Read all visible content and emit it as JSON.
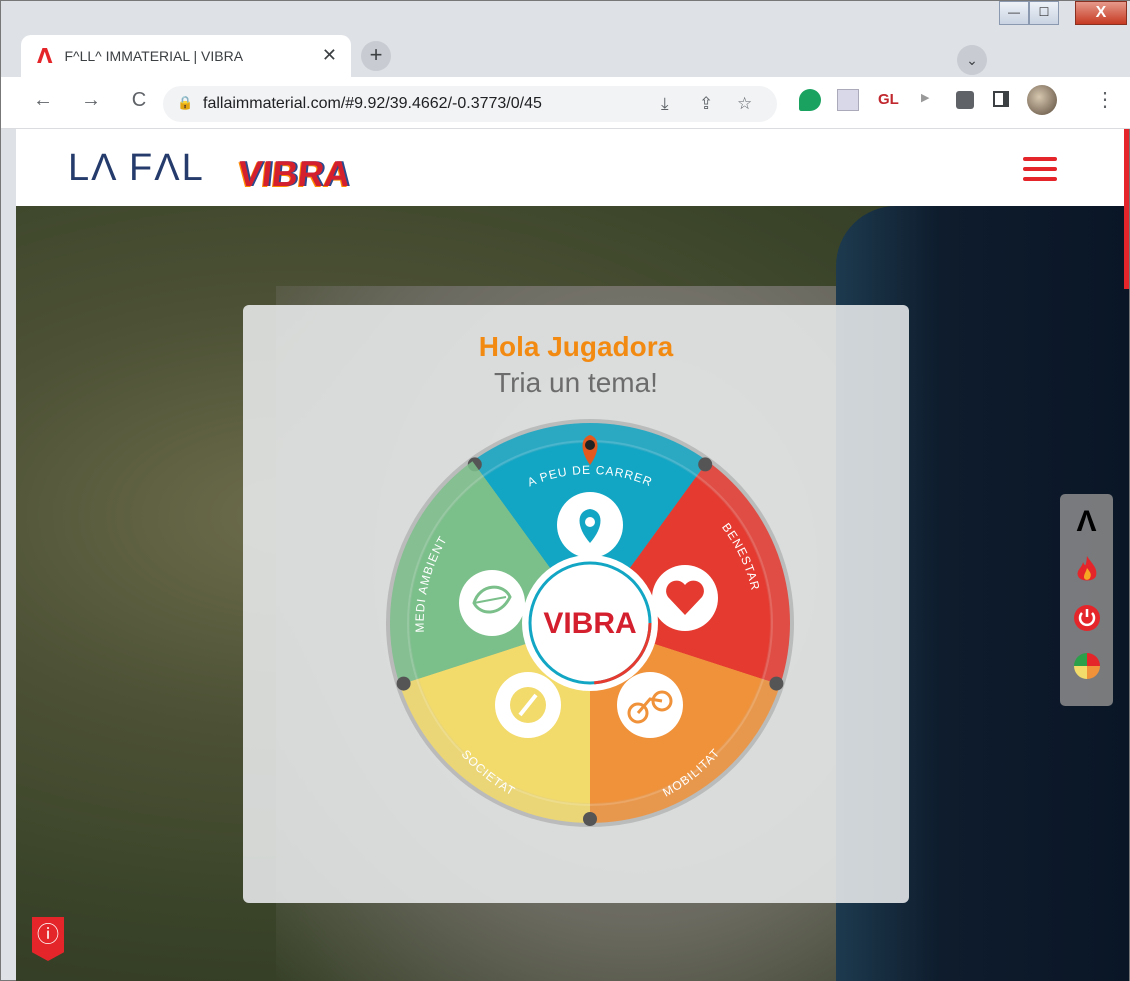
{
  "browser": {
    "tab_title": "F^LL^ IMMATERIAL | VIBRA",
    "tab_favicon": "Λ",
    "tab_close": "✕",
    "new_tab": "+",
    "tab_search": "⌄",
    "url": "fallaimmaterial.com/#9.92/39.4662/-0.3773/0/45",
    "window_minimize": "—",
    "window_maximize": "☐",
    "window_close": "X",
    "back": "←",
    "forward": "→",
    "reload": "C",
    "lock": "🔒",
    "install": "⤓",
    "share": "⇪",
    "star": "☆",
    "ext_gl": "GL",
    "menu": "⋮"
  },
  "site": {
    "logo_text": "LΛ FΛL",
    "logo_vibra": "VIBRA"
  },
  "game": {
    "greeting": "Hola Jugadora",
    "prompt": "Tria un tema!",
    "center_label": "VIBRA",
    "segments": [
      {
        "label": "A PEU DE CARRER",
        "color": "#12a6c4",
        "icon": "location-pin-icon"
      },
      {
        "label": "BENESTAR",
        "color": "#e53a2f",
        "icon": "heart-icon"
      },
      {
        "label": "MOBILITAT",
        "color": "#f0923a",
        "icon": "bicycle-icon"
      },
      {
        "label": "SOCIETAT",
        "color": "#f2da6b",
        "icon": "compass-icon"
      },
      {
        "label": "MEDI AMBIENT",
        "color": "#7bbf8b",
        "icon": "leaf-icon"
      }
    ]
  },
  "sidebar": {
    "items": [
      {
        "name": "falla-logo-icon",
        "glyph": "Λ",
        "color": "#f28a12"
      },
      {
        "name": "fire-icon",
        "glyph": "🔥",
        "color": "#e4262b"
      },
      {
        "name": "power-icon",
        "glyph": "⏻",
        "color": "#e4262b"
      },
      {
        "name": "color-wheel-icon",
        "glyph": "◕",
        "color": "#2b9f4a"
      }
    ]
  },
  "info_button": "ⓘ"
}
